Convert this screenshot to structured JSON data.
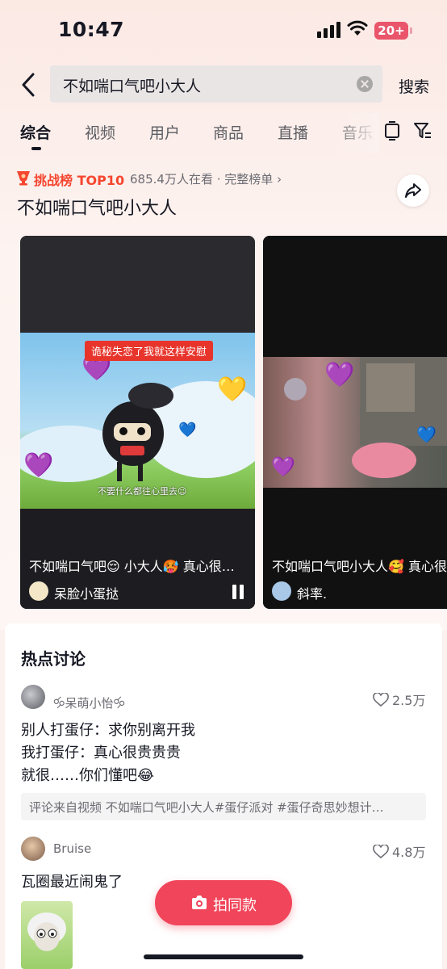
{
  "status_bar": {
    "time": "10:47",
    "battery": "20+"
  },
  "search": {
    "query": "不如喘口气吧小大人",
    "button_label": "搜索"
  },
  "tabs": [
    {
      "label": "综合",
      "active": true
    },
    {
      "label": "视频"
    },
    {
      "label": "用户"
    },
    {
      "label": "商品"
    },
    {
      "label": "直播"
    },
    {
      "label": "音乐"
    }
  ],
  "challenge": {
    "label": "挑战榜 TOP10",
    "viewers": "685.4万人在看",
    "separator": "·",
    "full_list": "完整榜单 ›",
    "title": "不如喘口气吧小大人"
  },
  "videos": [
    {
      "overlay_tag": "诡秘失恋了我就这样安慰",
      "subtitle": "不要什么都往心里去☺",
      "caption": "不如喘口气吧😌 小大人🥵 真心很…",
      "author": "呆脸小蛋挞",
      "playing": true
    },
    {
      "caption": "不如喘口气吧小大人🥰 真心很",
      "author": "斜率."
    }
  ],
  "hot_discussion": {
    "title": "热点讨论",
    "posts": [
      {
        "user": "🝰呆萌小怡🝰",
        "likes": "2.5万",
        "lines": [
          "别人打蛋仔：求你别离开我",
          "我打蛋仔：真心很贵贵贵",
          "就很……你们懂吧😂"
        ],
        "from_video": "评论来自视频 不如喘口气吧小大人#蛋仔派对 #蛋仔奇思妙想计…"
      },
      {
        "user": "Bruise",
        "likes": "4.8万",
        "lines": [
          "瓦圈最近闹鬼了"
        ]
      }
    ]
  },
  "shoot_button": "拍同款",
  "colors": {
    "accent": "#f0455a",
    "challenge": "#f5462f",
    "text": "#161823",
    "secondary": "#6b6b72"
  }
}
